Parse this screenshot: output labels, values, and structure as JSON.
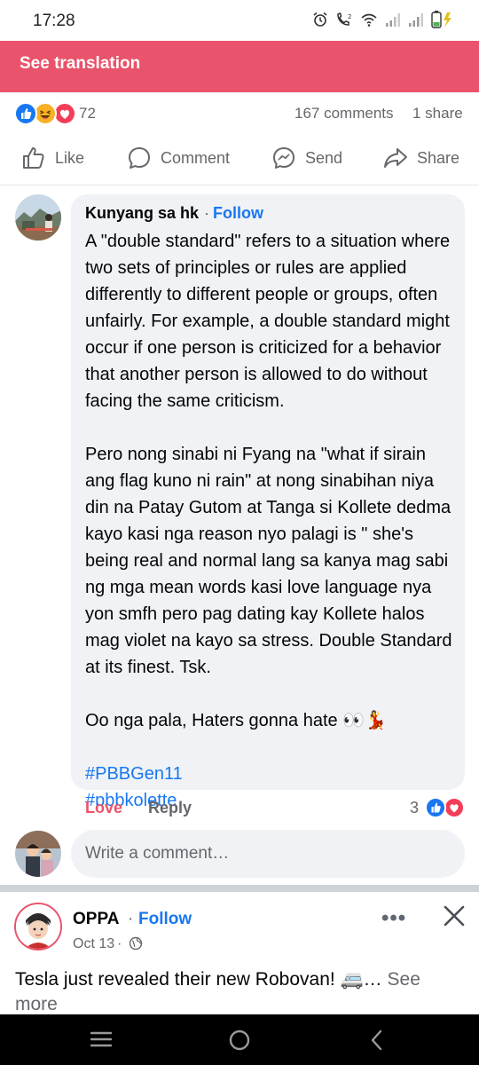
{
  "status_bar": {
    "time": "17:28"
  },
  "translation": {
    "label": "See translation"
  },
  "post_stats": {
    "reaction_count": "72",
    "comments": "167 comments",
    "shares": "1 share",
    "reactions": [
      "like",
      "haha",
      "love"
    ]
  },
  "actions": {
    "like": "Like",
    "comment": "Comment",
    "send": "Send",
    "share": "Share"
  },
  "comment": {
    "author": "Kunyang sa hk",
    "separator": "·",
    "follow": "Follow",
    "paragraph1": "A \"double standard\" refers to a situation where two sets of principles or rules are applied differently to different people or groups, often unfairly. For example, a double standard might occur if one person is criticized for a behavior that another person is allowed to do without facing the same criticism.",
    "paragraph2": "Pero nong sinabi ni Fyang na  \"what if sirain ang flag kuno ni rain\" at nong sinabihan niya din na Patay Gutom at Tanga si Kollete dedma kayo kasi nga reason nyo palagi is \" she's being real and normal lang sa kanya mag sabi ng mga mean words kasi love language nya yon smfh pero pag dating kay Kollete halos mag violet na kayo sa stress. Double Standard at its finest. Tsk.",
    "paragraph3": "Oo nga pala, Haters gonna hate 👀💃",
    "hashtag1": "#PBBGen11",
    "hashtag2": "#pbbkolette",
    "love_label": "Love",
    "reply_label": "Reply",
    "reaction_count": "3"
  },
  "write_comment": {
    "placeholder": "Write a comment…"
  },
  "next_post": {
    "author": "OPPA",
    "separator": "·",
    "follow": "Follow",
    "date": "Oct 13",
    "date_separator": "·",
    "more": "•••",
    "text": "Tesla just revealed their new Robovan! 🚐…",
    "see_more": "See more"
  },
  "colors": {
    "translation_bar": "#e9536b",
    "facebook_blue": "#1877f2",
    "love_red": "#e9536b",
    "bubble_gray": "#f0f2f5"
  },
  "icons": {
    "status": [
      "alarm-icon",
      "volte-icon",
      "wifi-icon",
      "signal-icon",
      "signal-icon",
      "battery-icon"
    ],
    "nav": [
      "recent-apps-icon",
      "home-icon",
      "back-icon"
    ]
  }
}
